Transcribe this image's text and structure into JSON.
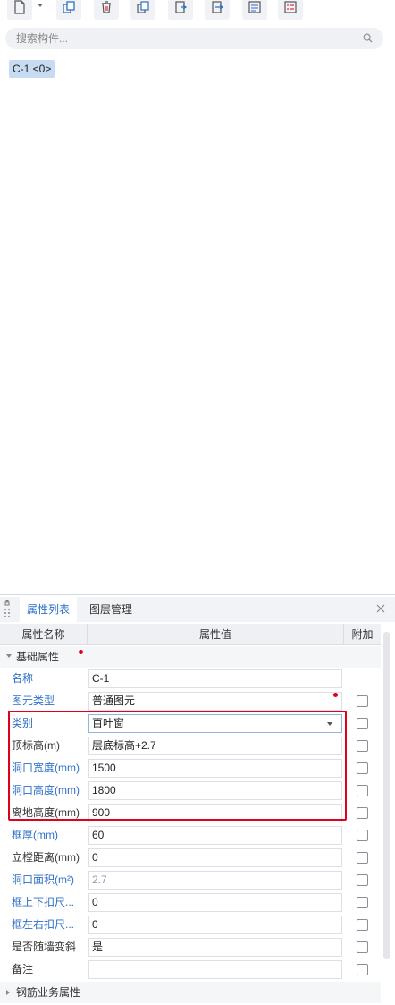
{
  "toolbar": {
    "buttons": [
      {
        "icon": "new-component-icon"
      },
      {
        "icon": "copy-icon"
      },
      {
        "icon": "delete-icon"
      },
      {
        "icon": "layer-copy-icon"
      },
      {
        "icon": "import-icon"
      },
      {
        "icon": "export-icon"
      },
      {
        "icon": "list-view-icon"
      },
      {
        "icon": "properties-icon"
      }
    ]
  },
  "search": {
    "placeholder": "搜索构件..."
  },
  "component_list": {
    "items": [
      {
        "label": "C-1 <0>"
      }
    ]
  },
  "panel": {
    "tabs": [
      {
        "label": "属性列表"
      },
      {
        "label": "图层管理"
      }
    ],
    "columns": {
      "name": "属性名称",
      "value": "属性值",
      "extra": "附加"
    },
    "groups": {
      "basic": "基础属性",
      "rebar": "钢筋业务属性"
    },
    "rows": [
      {
        "name": "名称",
        "value": "C-1"
      },
      {
        "name": "图元类型",
        "value": "普通图元"
      },
      {
        "name": "类别",
        "value": "百叶窗"
      },
      {
        "name": "顶标高(m)",
        "value": "层底标高+2.7"
      },
      {
        "name": "洞口宽度(mm)",
        "value": "1500"
      },
      {
        "name": "洞口高度(mm)",
        "value": "1800"
      },
      {
        "name": "离地高度(mm)",
        "value": "900"
      },
      {
        "name": "框厚(mm)",
        "value": "60"
      },
      {
        "name": "立樘距离(mm)",
        "value": "0"
      },
      {
        "name": "洞口面积(m²)",
        "value": "2.7"
      },
      {
        "name": "框上下扣尺...",
        "value": "0"
      },
      {
        "name": "框左右扣尺...",
        "value": "0"
      },
      {
        "name": "是否随墙变斜",
        "value": "是"
      },
      {
        "name": "备注",
        "value": ""
      }
    ]
  },
  "colors": {
    "accent": "#2d6fc7",
    "highlight": "#e0001b",
    "chip_bg": "#c7dbf2"
  }
}
